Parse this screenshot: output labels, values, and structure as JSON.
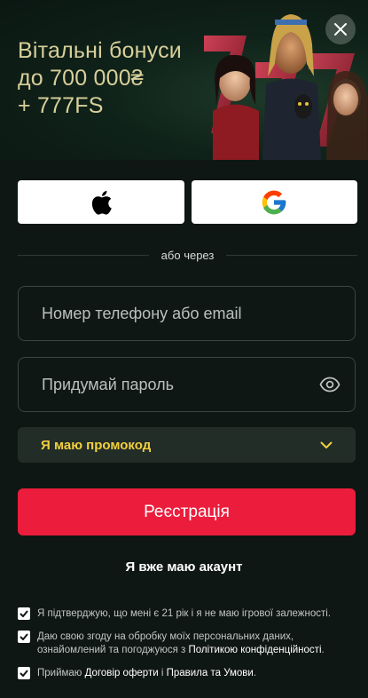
{
  "banner": {
    "title_line1": "Вітальні бонуси",
    "title_line2": "до 700 000₴",
    "title_line3": "+ 777FS",
    "close_icon": "close-icon"
  },
  "social": {
    "apple_icon": "apple-icon",
    "google_icon": "google-icon"
  },
  "divider_text": "або через",
  "form": {
    "phone_placeholder": "Номер телефону або email",
    "password_placeholder": "Придумай пароль",
    "password_toggle_icon": "eye-icon",
    "promo_label": "Я маю промокод",
    "promo_icon": "chevron-down-icon",
    "register_label": "Реєстрація",
    "login_label": "Я вже маю акаунт"
  },
  "consents": {
    "age_text": "Я підтверджую, що мені є 21 рік і я не маю ігрової залежності.",
    "privacy_text_a": "Даю свою згоду на обробку моїх персональних даних, ознайомлений та погоджуюся з ",
    "privacy_link": "Політикою конфіденційності",
    "privacy_text_b": ".",
    "terms_text_a": "Приймаю ",
    "terms_link1": "Договір оферти",
    "terms_text_b": " і ",
    "terms_link2": "Правила та Умови",
    "terms_text_c": "."
  },
  "colors": {
    "background": "#0f1714",
    "accent_red": "#ec1d3c",
    "promo_yellow": "#f2cf3e",
    "banner_gold": "#d8cf9a"
  }
}
